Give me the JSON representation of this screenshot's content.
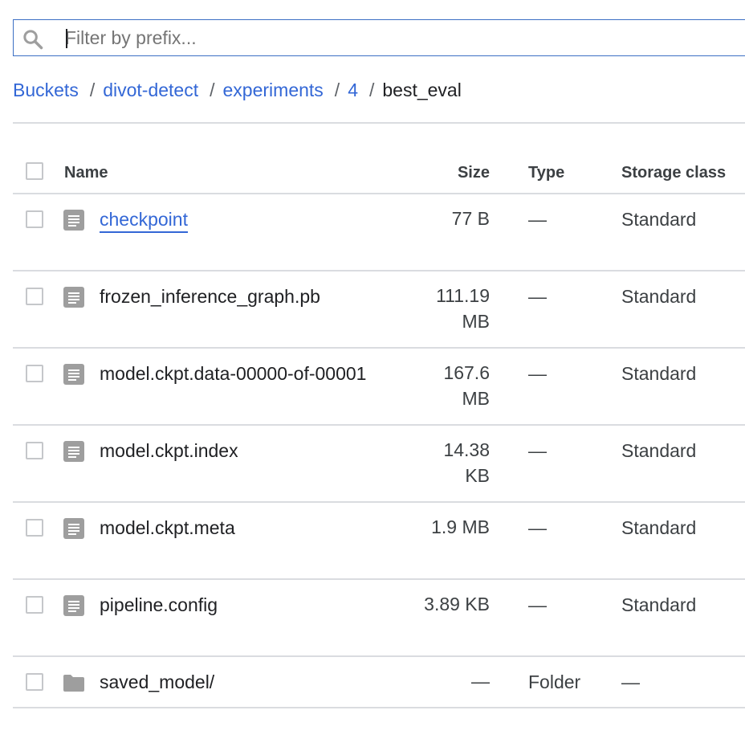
{
  "filter": {
    "placeholder": "Filter by prefix...",
    "value": ""
  },
  "breadcrumb": {
    "links": [
      "Buckets",
      "divot-detect",
      "experiments",
      "4"
    ],
    "separator": "/",
    "current": "best_eval"
  },
  "table": {
    "headers": {
      "name": "Name",
      "size": "Size",
      "type": "Type",
      "storage_class": "Storage class"
    },
    "rows": [
      {
        "name": "checkpoint",
        "size_1": "77 B",
        "size_2": "",
        "type": "—",
        "storage_class": "Standard",
        "icon": "file-icon"
      },
      {
        "name": "frozen_inference_graph.pb",
        "size_1": "111.19",
        "size_2": "MB",
        "type": "—",
        "storage_class": "Standard",
        "icon": "file-icon"
      },
      {
        "name": "model.ckpt.data-00000-of-00001",
        "size_1": "167.6",
        "size_2": "MB",
        "type": "—",
        "storage_class": "Standard",
        "icon": "file-icon"
      },
      {
        "name": "model.ckpt.index",
        "size_1": "14.38",
        "size_2": "KB",
        "type": "—",
        "storage_class": "Standard",
        "icon": "file-icon"
      },
      {
        "name": "model.ckpt.meta",
        "size_1": "1.9 MB",
        "size_2": "",
        "type": "—",
        "storage_class": "Standard",
        "icon": "file-icon"
      },
      {
        "name": "pipeline.config",
        "size_1": "3.89 KB",
        "size_2": "",
        "type": "—",
        "storage_class": "Standard",
        "icon": "file-icon"
      },
      {
        "name": "saved_model/",
        "size_1": "—",
        "size_2": "",
        "type": "Folder",
        "storage_class": "—",
        "icon": "folder-icon"
      }
    ]
  },
  "colors": {
    "accent": "#3367d6",
    "focus_border": "#3c6fc4",
    "divider": "#dadce0",
    "icon": "#9e9e9e"
  }
}
